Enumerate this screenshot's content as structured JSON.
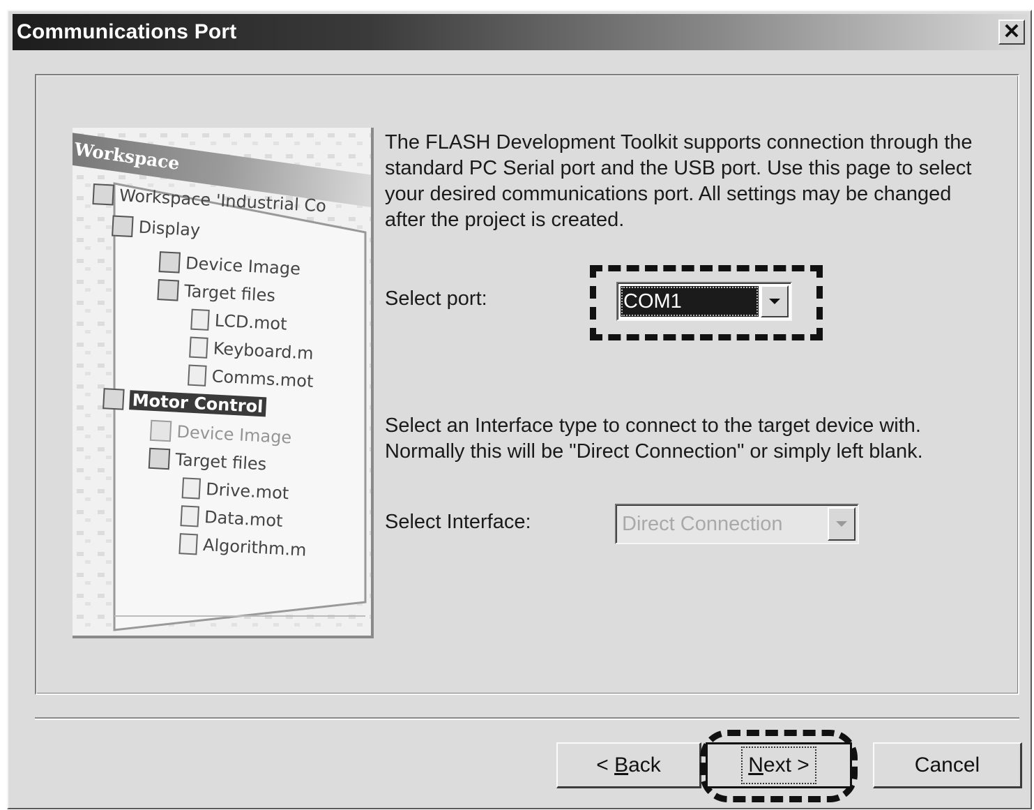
{
  "window": {
    "title": "Communications Port",
    "close_glyph": "✕",
    "close_icon": "close-icon"
  },
  "illustration": {
    "banner": "Workspace",
    "nodes": [
      {
        "label": "Workspace 'Industrial Co",
        "icon": "workspace-icon"
      },
      {
        "label": "Display",
        "icon": "project-icon"
      },
      {
        "label": "Device Image",
        "icon": "folder-icon"
      },
      {
        "label": "Target files",
        "icon": "folder-icon"
      },
      {
        "label": "LCD.mot",
        "icon": "file-icon"
      },
      {
        "label": "Keyboard.m",
        "icon": "file-icon"
      },
      {
        "label": "Comms.mot",
        "icon": "file-icon"
      },
      {
        "label": "Motor Control",
        "icon": "project-icon"
      },
      {
        "label": "Device Image",
        "icon": "folder-icon"
      },
      {
        "label": "Target files",
        "icon": "folder-icon"
      },
      {
        "label": "Drive.mot",
        "icon": "file-icon"
      },
      {
        "label": "Data.mot",
        "icon": "file-icon"
      },
      {
        "label": "Algorithm.m",
        "icon": "file-icon"
      }
    ]
  },
  "main": {
    "description": "The FLASH Development Toolkit supports connection through the standard PC Serial port and the USB port. Use this page to select your desired communications port. All settings may be changed after the project is created.",
    "port_label": "Select port:",
    "port_value": "COM1",
    "interface_help": "Select an Interface type to connect to the target device with. Normally this will be \"Direct Connection\" or simply left blank.",
    "interface_label": "Select Interface:",
    "interface_value": "Direct Connection"
  },
  "buttons": {
    "back_prefix": "< ",
    "back_accel": "B",
    "back_rest": "ack",
    "next_accel": "N",
    "next_rest": "ext >",
    "cancel": "Cancel"
  }
}
